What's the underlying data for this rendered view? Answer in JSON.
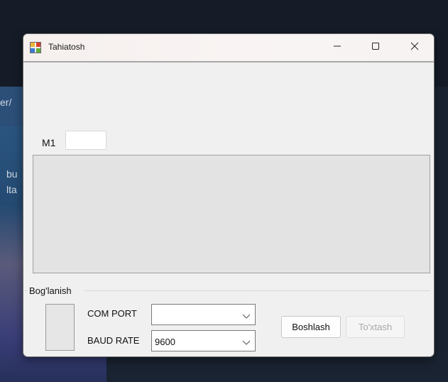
{
  "desktop": {
    "fragment_1": "er/",
    "fragment_2": "bu",
    "fragment_3": "lta"
  },
  "window": {
    "title": "Tahiatosh",
    "minimize_label": "—",
    "maximize_label": "☐",
    "close_label": "✕"
  },
  "m1": {
    "label": "M1",
    "value": ""
  },
  "connection": {
    "group_label": "Bog'lanish",
    "com_port_label": "COM PORT",
    "com_port_value": "",
    "baud_rate_label": "BAUD RATE",
    "baud_rate_value": "9600",
    "connect_label": "Boshlash",
    "disconnect_label": "To'xtash",
    "disconnect_enabled": false
  },
  "colors": {
    "window_bg": "#f0f0f0",
    "panel_bg": "#e3e3e3",
    "disabled_text": "#a8a8a8",
    "desktop_bg": "#1a2332"
  }
}
